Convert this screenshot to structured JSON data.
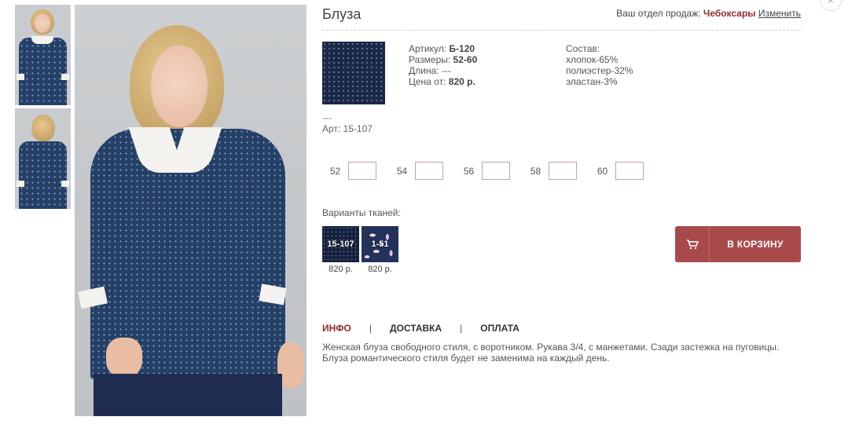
{
  "product": {
    "title": "Блуза",
    "sku_label": "Артикул:",
    "sku_value": "Б-120",
    "sizes_label": "Размеры:",
    "sizes_value": "52-60",
    "length_label": "Длина:",
    "length_value": "---",
    "price_label": "Цена от:",
    "price_value": "820 р.",
    "composition_label": "Состав:",
    "composition": [
      "хлопок-65%",
      "полиэстер-32%",
      "эластан-3%"
    ],
    "dash": "---",
    "art": "Арт: 15-107"
  },
  "department": {
    "label": "Ваш отдел продаж:",
    "city": "Чебоксары",
    "change": "Изменить"
  },
  "close_icon": "×",
  "size_options": [
    "52",
    "54",
    "56",
    "58",
    "60"
  ],
  "fabrics": {
    "label": "Варианты тканей:",
    "items": [
      {
        "code": "15-107",
        "price": "820 р."
      },
      {
        "code": "1-51",
        "price": "820 р."
      }
    ]
  },
  "cart_button": {
    "label": "В КОРЗИНУ",
    "icon": "cart-icon"
  },
  "tabs": [
    {
      "label": "ИНФО",
      "active": true
    },
    {
      "label": "ДОСТАВКА",
      "active": false
    },
    {
      "label": "ОПЛАТА",
      "active": false
    }
  ],
  "tab_separator": "|",
  "description": {
    "line1": "Женская блуза свободного стиля, с воротником. Рукава 3/4, с манжетами. Сзади застежка на пуговицы.",
    "line2": "Блуза романтического стиля будет не заменима на каждый день."
  },
  "colors": {
    "accent": "#a84a4c",
    "city": "#8f2b2e",
    "blouse": "#253f66"
  }
}
